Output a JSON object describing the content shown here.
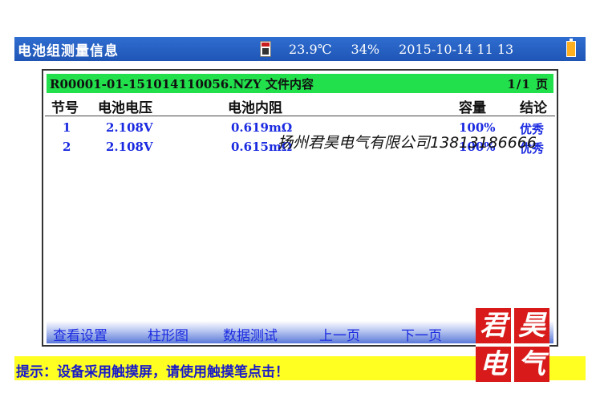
{
  "header": {
    "title": "电池组测量信息",
    "temperature": "23.9℃",
    "humidity": "34%",
    "datetime": "2015-10-14  11 13",
    "sd_icon": "sd-card-icon",
    "battery_icon": "battery-icon"
  },
  "file": {
    "name": "R00001-01-151014110056.NZY  文件内容",
    "page": "1/1    页"
  },
  "table": {
    "columns": [
      "节号",
      "电池电压",
      "电池内阻",
      "容量",
      "结论"
    ],
    "rows": [
      [
        "1",
        "2.108V",
        "0.619mΩ",
        "100%",
        "优秀"
      ],
      [
        "2",
        "2.108V",
        "0.615mΩ",
        "100%",
        "优秀"
      ]
    ]
  },
  "nav": {
    "view_settings": "查看设置",
    "bar_chart": "柱形图",
    "data_test": "数据测试",
    "prev_page": "上一页",
    "next_page": "下一页"
  },
  "hint": "提示：设备采用触摸屏，请使用触摸笔点击！",
  "watermark": "扬州君昊电气有限公司13813186666",
  "seal": [
    "君",
    "昊",
    "电",
    "气"
  ],
  "colors": {
    "title_bar": "#2f6dd0",
    "file_bar": "#22e04c",
    "hint_bar": "#ffff22",
    "data_text": "#1a2ae0",
    "seal": "#d81a1a"
  }
}
